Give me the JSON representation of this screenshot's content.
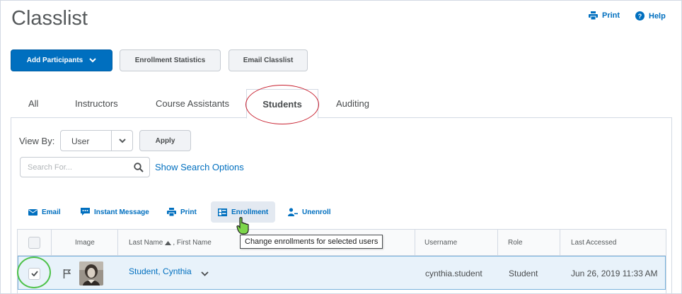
{
  "page": {
    "title": "Classlist"
  },
  "header_links": {
    "print": "Print",
    "help": "Help"
  },
  "buttons": {
    "add_participants": "Add Participants",
    "enrollment_statistics": "Enrollment Statistics",
    "email_classlist": "Email Classlist"
  },
  "tabs": [
    {
      "label": "All"
    },
    {
      "label": "Instructors"
    },
    {
      "label": "Course Assistants"
    },
    {
      "label": "Students",
      "active": true
    },
    {
      "label": "Auditing"
    }
  ],
  "filters": {
    "view_by_label": "View By:",
    "view_by_value": "User",
    "apply": "Apply",
    "search_placeholder": "Search For...",
    "show_search_options": "Show Search Options"
  },
  "actions": {
    "email": "Email",
    "instant_message": "Instant Message",
    "print": "Print",
    "enrollment": "Enrollment",
    "unenroll": "Unenroll"
  },
  "tooltip": "Change enrollments for selected users",
  "table": {
    "headers": {
      "image": "Image",
      "last_name": "Last Name",
      "first_name": ", First Name",
      "username": "Username",
      "role": "Role",
      "last_accessed": "Last Accessed"
    },
    "rows": [
      {
        "name": "Student, Cynthia",
        "username": "cynthia.student",
        "role": "Student",
        "last_accessed": "Jun 26, 2019 11:33 AM",
        "selected": true
      }
    ]
  },
  "colors": {
    "accent": "#006fbf",
    "highlight_circle": "#c8202f",
    "selected_row": "#e8f2fa",
    "check_circle": "#4ec24a"
  }
}
